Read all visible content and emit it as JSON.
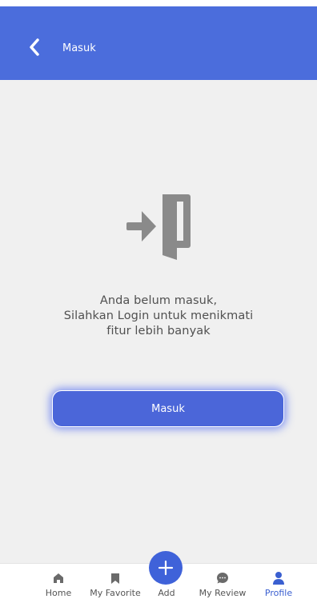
{
  "app_bar": {
    "title": "Masuk",
    "back_icon": "chevron-left-icon",
    "background": "#4b6ddc"
  },
  "content": {
    "icon": "login-door-icon",
    "message_lines": [
      "Anda belum masuk,",
      "Silahkan Login untuk menikmati",
      "fitur lebih banyak"
    ],
    "login_button_label": "Masuk",
    "background": "#f0f0f0"
  },
  "bottom_nav": {
    "items": [
      {
        "label": "Home",
        "icon": "home-icon"
      },
      {
        "label": "My Favorite",
        "icon": "bookmark-icon"
      },
      {
        "label": "Add",
        "icon": "plus-icon"
      },
      {
        "label": "My Review",
        "icon": "chat-bubble-icon"
      },
      {
        "label": "Profile",
        "icon": "user-icon",
        "active": true
      }
    ],
    "accent": "#3a5fd0"
  }
}
